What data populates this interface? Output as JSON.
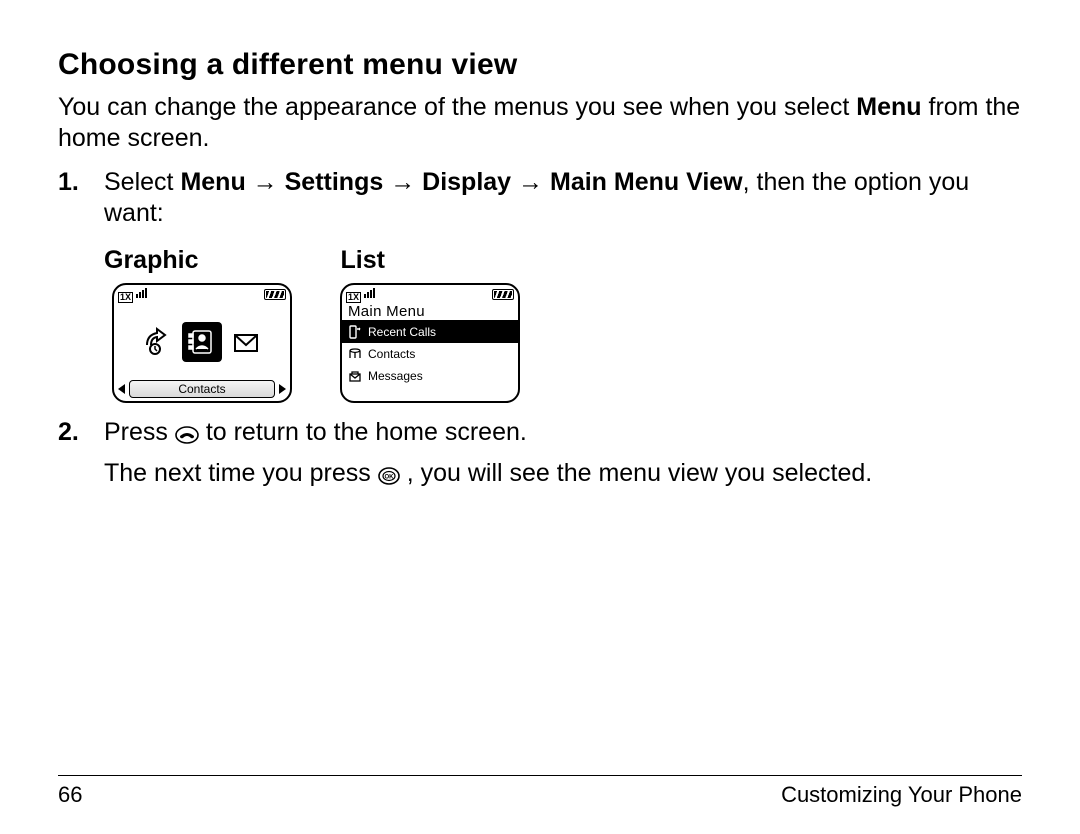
{
  "heading": "Choosing a different menu view",
  "intro_pre": "You can change the appearance of the menus you see when you select ",
  "intro_bold": "Menu",
  "intro_post": " from the home screen.",
  "step1": {
    "num": "1.",
    "pre": "Select ",
    "path1": "Menu",
    "arrow": " → ",
    "path2": "Settings",
    "path3": "Display",
    "path4": "Main Menu View",
    "post": ", then the option you want:"
  },
  "labels": {
    "graphic": "Graphic",
    "list": "List"
  },
  "graphic_screen": {
    "contacts": "Contacts"
  },
  "list_screen": {
    "title": "Main Menu",
    "items": [
      "Recent Calls",
      "Contacts",
      "Messages"
    ]
  },
  "step2": {
    "num": "2.",
    "line1_pre": "Press ",
    "line1_post": " to return to the home screen.",
    "line2_pre": "The next time you press ",
    "line2_post": " , you will see the menu view you selected."
  },
  "footer": {
    "page": "66",
    "section": "Customizing Your Phone"
  }
}
